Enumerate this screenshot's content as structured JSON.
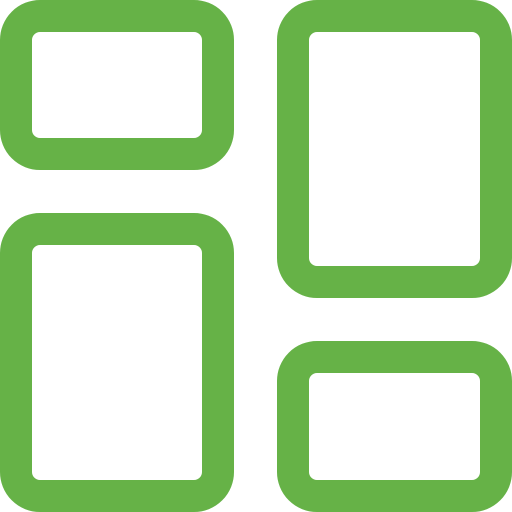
{
  "icon": {
    "name": "dashboard-layout-icon",
    "stroke_color": "#66b247",
    "fill_color": "#ffffff"
  }
}
